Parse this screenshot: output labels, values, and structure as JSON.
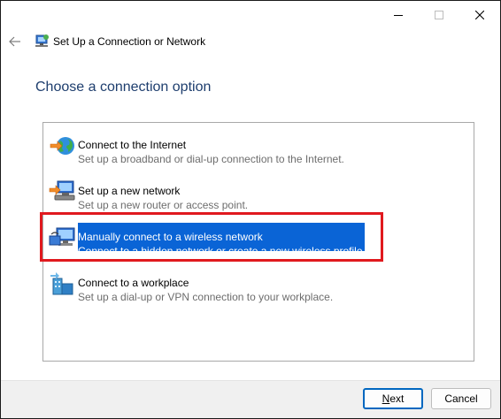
{
  "window": {
    "title": "Set Up a Connection or Network"
  },
  "heading": "Choose a connection option",
  "options": [
    {
      "label": "Connect to the Internet",
      "description": "Set up a broadband or dial-up connection to the Internet.",
      "icon": "internet-globe-icon",
      "selected": false
    },
    {
      "label": "Set up a new network",
      "description": "Set up a new router or access point.",
      "icon": "new-network-icon",
      "selected": false
    },
    {
      "label": "Manually connect to a wireless network",
      "description": "Connect to a hidden network or create a new wireless profile.",
      "icon": "wireless-network-icon",
      "selected": true
    },
    {
      "label": "Connect to a workplace",
      "description": "Set up a dial-up or VPN connection to your workplace.",
      "icon": "workplace-icon",
      "selected": false
    }
  ],
  "footer": {
    "next_label_underlined": "N",
    "next_label_rest": "ext",
    "cancel_label": "Cancel"
  },
  "colors": {
    "heading": "#1e3e6e",
    "selection": "#0a64d6",
    "highlight_box": "#e0191e",
    "default_button_border": "#0067c0"
  }
}
